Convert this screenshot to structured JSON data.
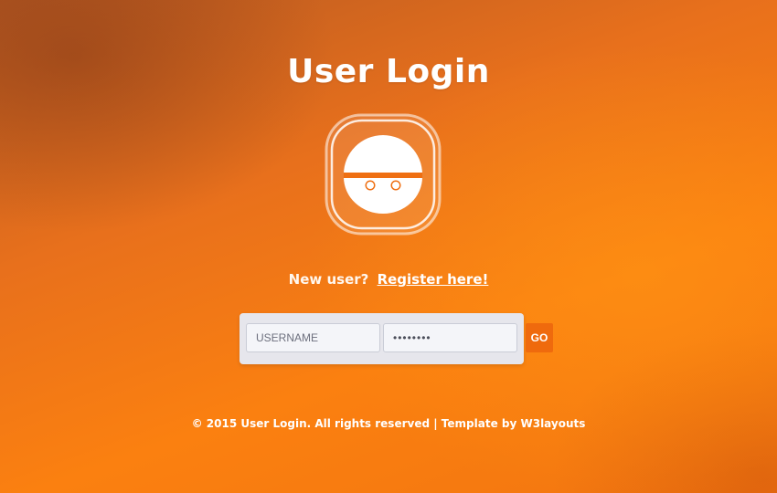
{
  "page": {
    "title": "User Login"
  },
  "avatar": {
    "icon": "smiley-face-icon"
  },
  "register": {
    "prompt": "New user?",
    "link_label": "Register here!"
  },
  "login_form": {
    "username_placeholder": "USERNAME",
    "password_value": "••••••••",
    "submit_label": "GO"
  },
  "footer": {
    "text": "© 2015 User Login. All rights reserved | Template by W3layouts"
  },
  "colors": {
    "background_accent": "#f57a12",
    "button": "#ef6a0d",
    "panel": "#e6e6ec"
  }
}
